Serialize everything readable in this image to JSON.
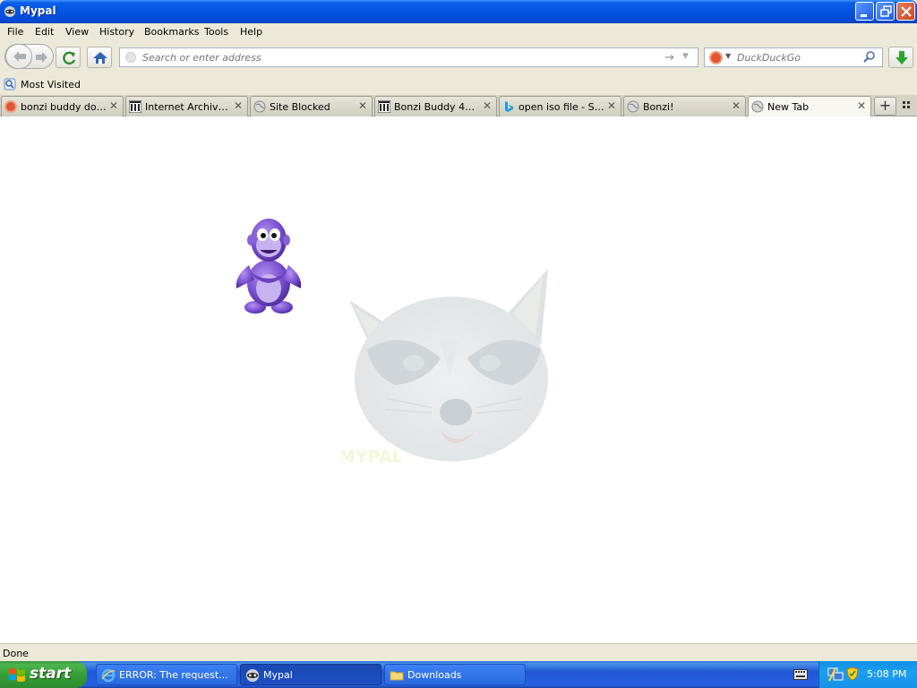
{
  "window": {
    "title": "Mypal"
  },
  "menu": [
    "File",
    "Edit",
    "View",
    "History",
    "Bookmarks",
    "Tools",
    "Help"
  ],
  "navbar": {
    "url_placeholder": "Search or enter address",
    "search_placeholder": "DuckDuckGo"
  },
  "bookmarks": {
    "most_visited": "Most Visited"
  },
  "tabs": [
    {
      "label": "bonzi buddy dow...",
      "icon": "duckduckgo-icon",
      "selected": false
    },
    {
      "label": "Internet Archive: ...",
      "icon": "archive-icon",
      "selected": false
    },
    {
      "label": "Site Blocked",
      "icon": "globe-icon",
      "selected": false
    },
    {
      "label": "Bonzi Buddy 432 :...",
      "icon": "archive-icon",
      "selected": false
    },
    {
      "label": "open iso file - Sea...",
      "icon": "bing-icon",
      "selected": false
    },
    {
      "label": "Bonzi!",
      "icon": "globe-icon",
      "selected": false
    },
    {
      "label": "New Tab",
      "icon": "globe-icon",
      "selected": true
    }
  ],
  "content": {
    "watermark_text": "MYPAL"
  },
  "status": {
    "text": "Done"
  },
  "taskbar": {
    "start_label": "start",
    "items": [
      {
        "label": "ERROR: The request...",
        "icon": "ie-icon",
        "active": false
      },
      {
        "label": "Mypal",
        "icon": "mypal-icon",
        "active": true
      },
      {
        "label": "Downloads",
        "icon": "folder-icon",
        "active": false
      }
    ],
    "clock": "5:08 PM"
  }
}
